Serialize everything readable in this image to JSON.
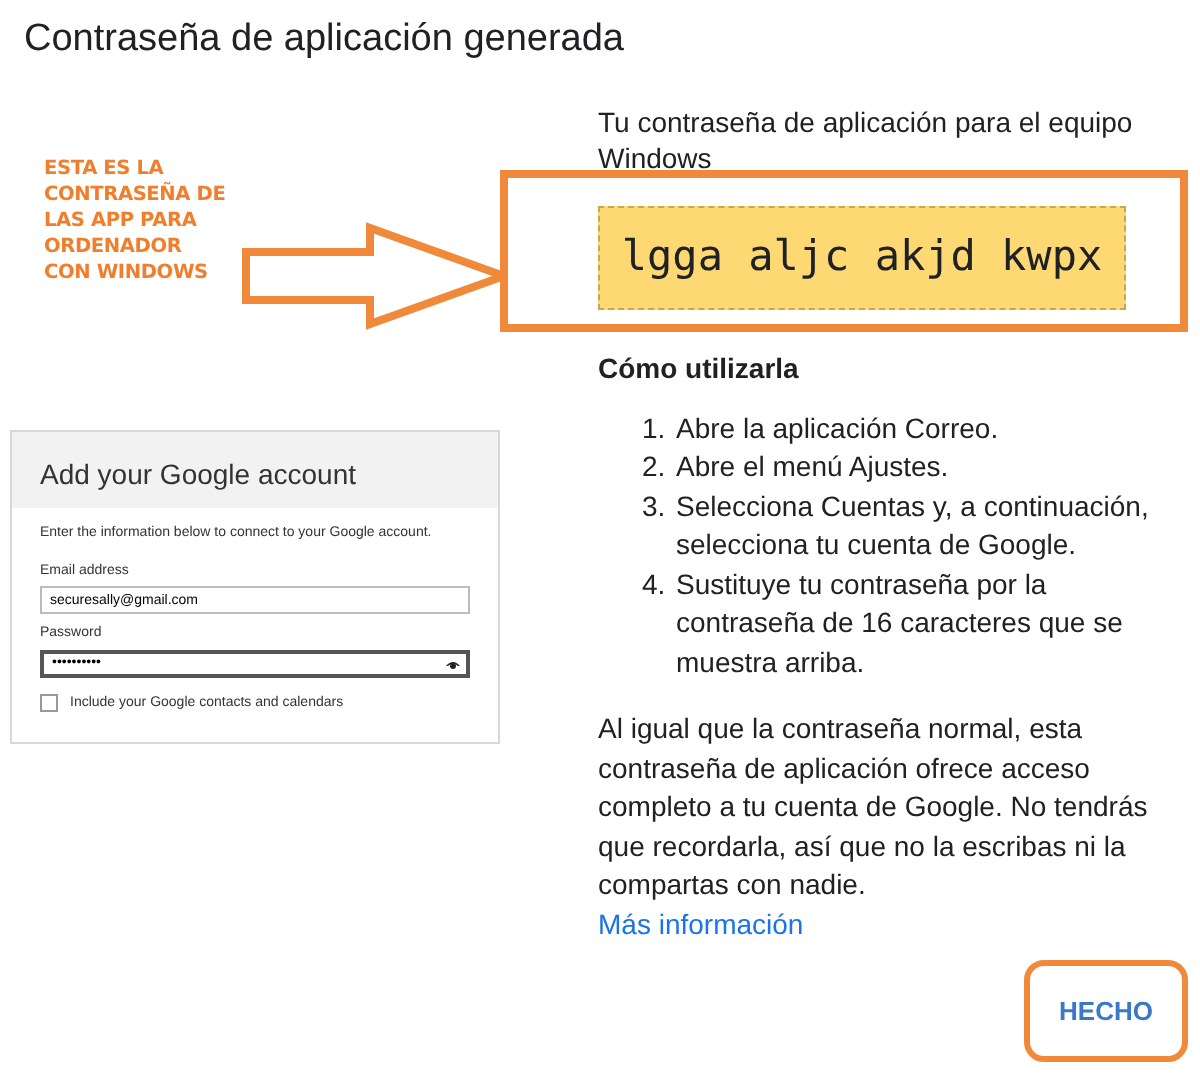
{
  "title": "Contraseña de aplicación generada",
  "annotation": {
    "lines": [
      "ESTA ES LA",
      "CONTRASEÑA DE",
      "LAS APP PARA",
      "ORDENADOR",
      "CON WINDOWS"
    ]
  },
  "dialog": {
    "title": "Add your Google account",
    "intro": "Enter the information below to connect to your Google account.",
    "fields": [
      {
        "label": "Email address",
        "value": "securesally@gmail.com",
        "kind": "text"
      },
      {
        "label": "Password",
        "value": "••••••••••",
        "kind": "password"
      }
    ],
    "checkbox": {
      "label": "Include your Google contacts and calendars",
      "checked": false
    }
  },
  "heading": "Tu contraseña de aplicación para el equipo Windows",
  "password": "lgga aljc akjd kwpx",
  "how_title": "Cómo utilizarla",
  "steps": [
    {
      "number": "1.",
      "text": "Abre la aplicación Correo."
    },
    {
      "number": "2.",
      "text": "Abre el menú Ajustes."
    },
    {
      "number": "3.",
      "text": "Selecciona Cuentas y, a continuación, selecciona tu cuenta de Google."
    },
    {
      "number": "4.",
      "text": "Sustituye tu contraseña por la contraseña de 16 caracteres que se muestra arriba."
    }
  ],
  "note": "Al igual que la contraseña normal, esta contraseña de aplicación ofrece acceso completo a tu cuenta de Google. No tendrás que recordarla, así que no la escribas ni la compartas con nadie.",
  "link": "Más información",
  "done_button": "HECHO"
}
